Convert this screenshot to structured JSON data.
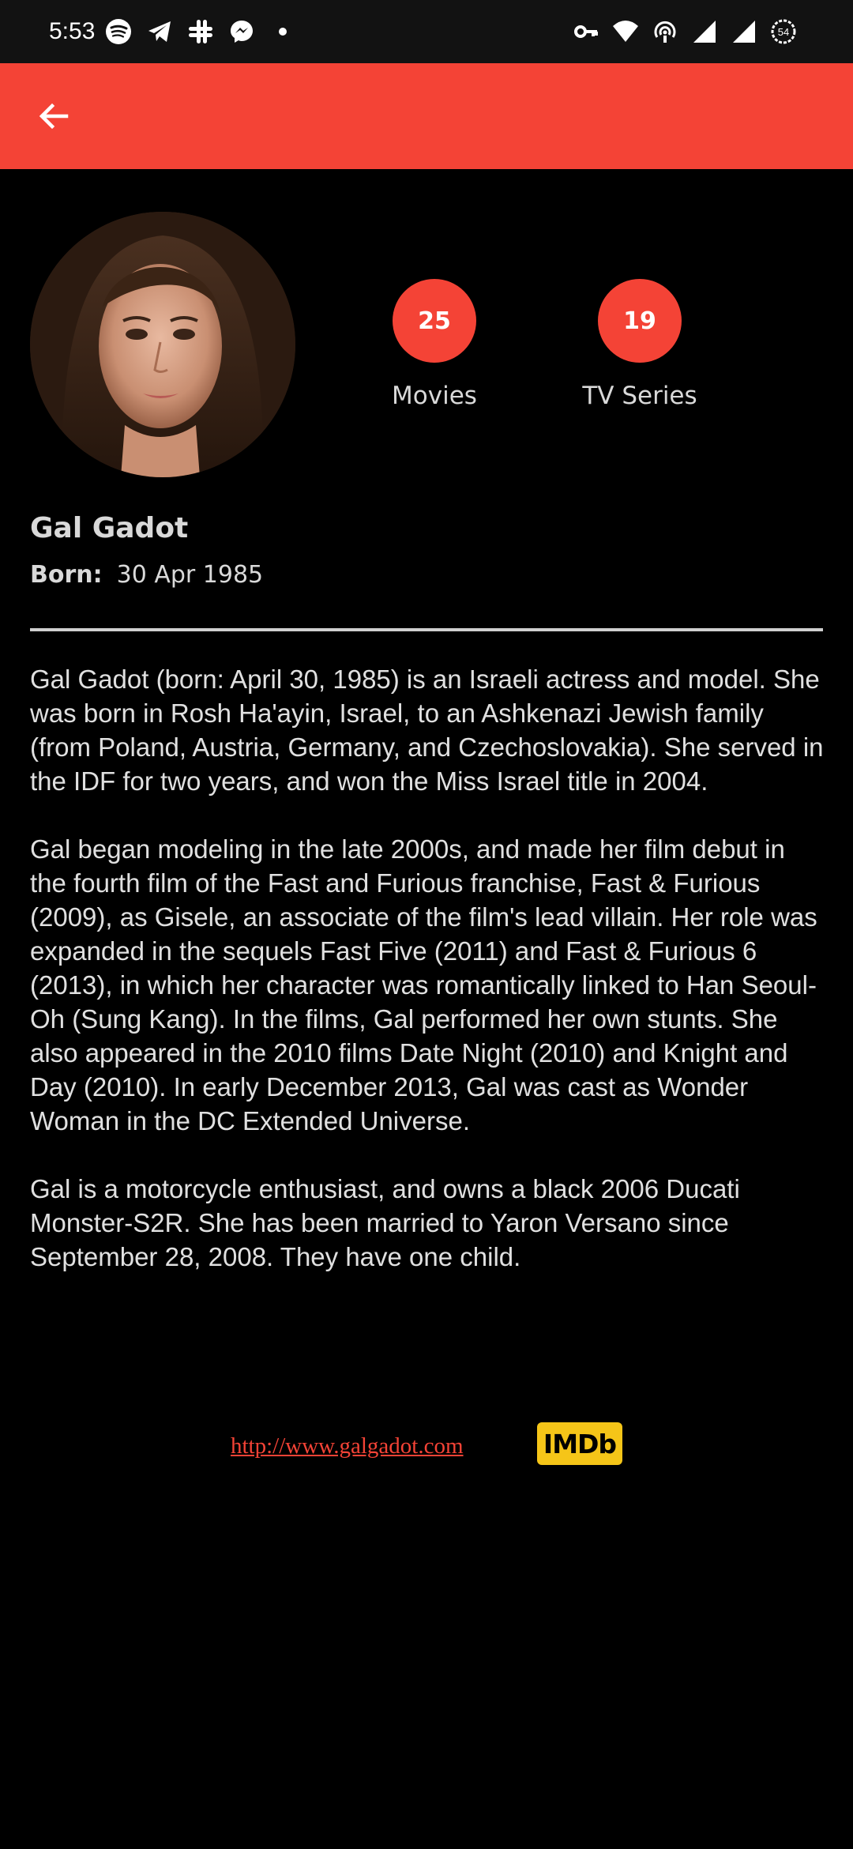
{
  "status_bar": {
    "time": "5:53",
    "left_icons": [
      "spotify-icon",
      "telegram-icon",
      "slack-icon",
      "messenger-icon",
      "dot-icon"
    ],
    "right_icons": [
      "vpn-key-icon",
      "wifi-icon",
      "hotspot-icon",
      "signal-icon",
      "signal-icon",
      "battery-icon"
    ],
    "battery_level": "54"
  },
  "app_bar": {
    "back_icon": "arrow-back-icon",
    "color": "#f44336"
  },
  "profile": {
    "avatar": "person-photo",
    "stats": [
      {
        "value": "25",
        "label": "Movies"
      },
      {
        "value": "19",
        "label": "TV Series"
      }
    ],
    "name": "Gal Gadot",
    "born_label": "Born:",
    "born_value": "30 Apr 1985"
  },
  "biography": {
    "paragraphs": [
      "Gal Gadot (born: April 30, 1985) is an Israeli actress and model. She was born in Rosh Ha'ayin, Israel, to an Ashkenazi Jewish family (from Poland, Austria, Germany, and Czechoslovakia). She served in the IDF for two years, and won the Miss Israel title in 2004.",
      "Gal began modeling in the late 2000s, and made her film debut in the fourth film of the Fast and Furious franchise, Fast & Furious (2009), as Gisele, an associate of the film's lead villain. Her role was expanded in the sequels Fast Five (2011) and Fast & Furious 6 (2013), in which her character was romantically linked to Han Seoul-Oh (Sung Kang). In the films, Gal performed her own stunts. She also appeared in the 2010 films Date Night (2010) and Knight and Day (2010). In early December 2013, Gal was cast as Wonder Woman in the DC Extended Universe.",
      "Gal is a motorcycle enthusiast, and owns a black 2006 Ducati Monster-S2R. She has been married to Yaron Versano since September 28, 2008. They have one child."
    ]
  },
  "links": {
    "website": "http://www.galgadot.com",
    "imdb": "IMDb"
  },
  "colors": {
    "accent": "#f44336",
    "background": "#000000",
    "imdb_yellow": "#f5c518"
  }
}
